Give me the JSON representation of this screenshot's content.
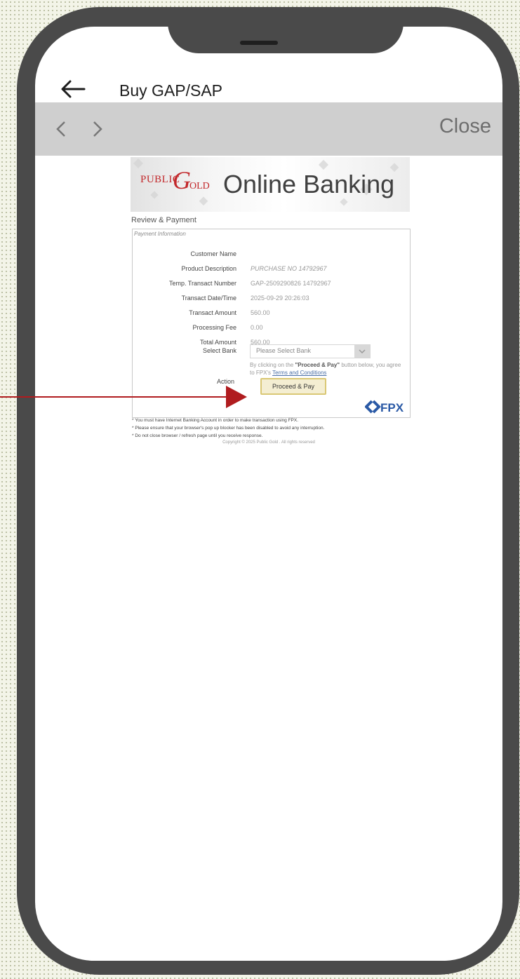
{
  "app": {
    "title": "Buy GAP/SAP"
  },
  "browser": {
    "close_label": "Close"
  },
  "banner": {
    "logo_public": "PUBLIC",
    "logo_g": "G",
    "logo_old": "OLD",
    "title": "Online Banking"
  },
  "review": {
    "section_title": "Review & Payment",
    "caption": "Payment Information",
    "rows": [
      {
        "label": "Customer Name",
        "value": ""
      },
      {
        "label": "Product Description",
        "value": "PURCHASE NO 14792967"
      },
      {
        "label": "Temp. Transact Number",
        "value": "GAP-2509290826 14792967"
      },
      {
        "label": "Transact Date/Time",
        "value": "2025-09-29 20:26:03"
      },
      {
        "label": "Transact Amount",
        "value": "560.00"
      },
      {
        "label": "Processing Fee",
        "value": "0.00"
      },
      {
        "label": "Total Amount",
        "value": "560.00"
      }
    ],
    "select_label": "Select Bank",
    "select_placeholder": "Please Select Bank",
    "action_label": "Action",
    "notice_prefix": "By clicking on the ",
    "notice_bold": "\"Proceed & Pay\"",
    "notice_mid": " button below, you agree to FPX's ",
    "notice_link": "Terms and Conditions",
    "proceed_button": "Proceed & Pay"
  },
  "footer": {
    "notes": [
      "* You must have Internet Banking Account in order to make transaction using FPX.",
      "* Please ensure that your browser's pop up blocker has been disabled to avoid any interruption.",
      "* Do not close browser / refresh page until you receive response."
    ],
    "fpx_label": "FPX",
    "copyright": "Copyright © 2025 Public Gold . All rights reserved"
  },
  "colors": {
    "accent_red": "#c2282b",
    "annotation": "#b01c1f",
    "fpx_blue": "#2b5aa6"
  }
}
